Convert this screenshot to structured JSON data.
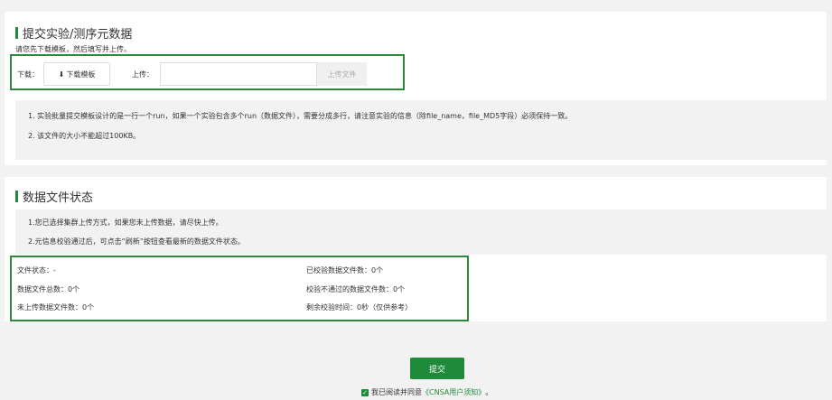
{
  "upload_section": {
    "title": "提交实验/测序元数据",
    "subtitle": "请您先下载模板，然后填写并上传。",
    "download_label": "下载：",
    "download_button": "下载模板",
    "upload_label": "上传：",
    "upload_button": "上传文件",
    "notes": [
      "1. 实验批量提交模板设计的是一行一个run，如果一个实验包含多个run（数据文件），需要分成多行，请注意实验的信息（除file_name，file_MD5字段）必须保持一致。",
      "2. 该文件的大小不能超过100KB。"
    ]
  },
  "status_section": {
    "title": "数据文件状态",
    "notes": [
      "1.您已选择集群上传方式，如果您未上传数据，请尽快上传。",
      "2.元信息校验通过后，可点击“刷新”按钮查看最新的数据文件状态。"
    ],
    "left": [
      "文件状态：-",
      "数据文件总数：0个",
      "未上传数据文件数：0个"
    ],
    "right": [
      "已校验数据文件数：0个",
      "校验不通过的数据文件数：0个",
      "剩余校验时间：0秒（仅供参考）"
    ]
  },
  "footer": {
    "submit_button": "提交",
    "agree_prefix": "我已阅读并同意",
    "agree_link": "《CNSA用户须知》",
    "agree_suffix": "。"
  },
  "colors": {
    "accent": "#1e8a3a",
    "highlight_border": "#2d8a3a"
  }
}
